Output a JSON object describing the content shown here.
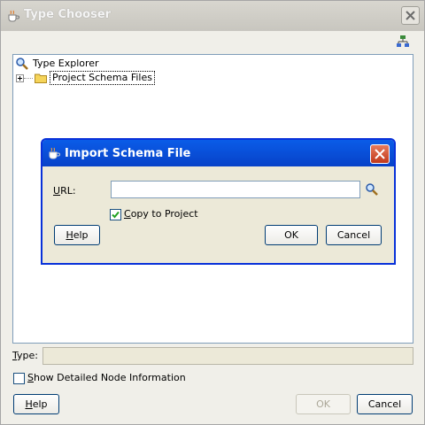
{
  "window": {
    "title": "Type Chooser",
    "icons": {
      "app": "coffee-cup-icon",
      "close": "close-icon",
      "toolbar": "hierarchy-icon"
    }
  },
  "tree": {
    "root_label": "Type Explorer",
    "root_icon": "search-icon",
    "children": [
      {
        "label": "Project Schema Files",
        "icon": "folder-icon",
        "selected": true,
        "expanded": false
      }
    ]
  },
  "type_field": {
    "label": "Type:",
    "value": ""
  },
  "show_details": {
    "label": "Show Detailed Node Information",
    "checked": false
  },
  "buttons": {
    "help": "Help",
    "ok": "OK",
    "cancel": "Cancel",
    "ok_enabled": false
  },
  "dialog": {
    "title": "Import Schema File",
    "url_label": "URL:",
    "url_value": "",
    "copy_to_project": {
      "label": "Copy to Project",
      "checked": true
    },
    "help": "Help",
    "ok": "OK",
    "cancel": "Cancel",
    "colors": {
      "title_bar": "#0a5ce8",
      "close_button": "#d9542d"
    }
  }
}
